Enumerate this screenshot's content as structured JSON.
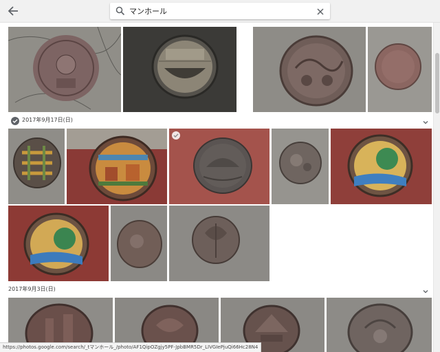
{
  "search": {
    "query": "マンホール",
    "back_icon": "arrow-left-icon",
    "search_icon": "magnifier-icon",
    "clear_icon": "close-icon"
  },
  "sections": [
    {
      "date": "2017年9月17日(日)",
      "selected": true
    },
    {
      "date": "2017年9月3日(日)",
      "selected": false
    }
  ],
  "photos": {
    "row1": [
      "manhole-1",
      "manhole-2",
      "manhole-3",
      "manhole-4"
    ],
    "row2": [
      "manhole-5",
      "manhole-6",
      "manhole-7",
      "manhole-8",
      "manhole-9"
    ],
    "row3": [
      "manhole-10",
      "manhole-11",
      "manhole-12"
    ],
    "row4": [
      "manhole-13",
      "manhole-14",
      "manhole-15",
      "manhole-16"
    ]
  },
  "colors": {
    "topbar": "#f1f1f1",
    "accent_check": "#5f6368"
  },
  "status_bar": {
    "url": "https://photos.google.com/search/_tマンホール_/photo/AF1QipOZgjy5PF-JpbBMR5Dr_LIVGIePjuQi66Hc28N4"
  }
}
